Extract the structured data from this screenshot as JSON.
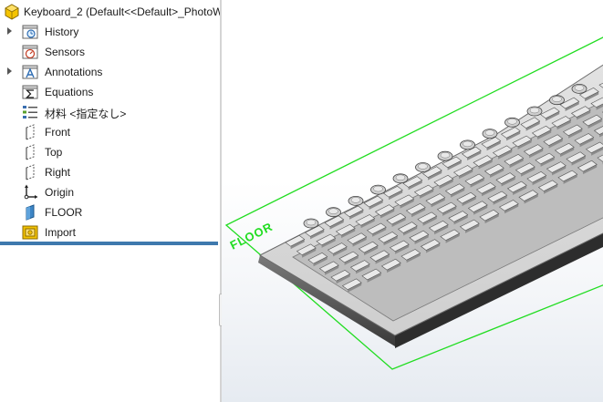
{
  "tree": {
    "root_label": "Keyboard_2  (Default<<Default>_PhotoW",
    "items": [
      {
        "label": "History",
        "expandable": true,
        "icon": "history-folder-icon"
      },
      {
        "label": "Sensors",
        "expandable": false,
        "icon": "sensors-icon"
      },
      {
        "label": "Annotations",
        "expandable": true,
        "icon": "annotations-icon"
      },
      {
        "label": "Equations",
        "expandable": false,
        "icon": "equations-icon"
      },
      {
        "label": "材料 <指定なし>",
        "expandable": false,
        "icon": "material-icon"
      },
      {
        "label": "Front",
        "expandable": false,
        "icon": "plane-icon"
      },
      {
        "label": "Top",
        "expandable": false,
        "icon": "plane-icon"
      },
      {
        "label": "Right",
        "expandable": false,
        "icon": "plane-icon"
      },
      {
        "label": "Origin",
        "expandable": false,
        "icon": "origin-icon"
      },
      {
        "label": "FLOOR",
        "expandable": false,
        "icon": "floor-plane-icon"
      },
      {
        "label": "Import",
        "expandable": false,
        "icon": "import-part-icon"
      }
    ]
  },
  "viewport": {
    "floor_label": "FLOOR",
    "colors": {
      "floor_outline": "#22dd22",
      "keyboard_body": "#d9d9d9",
      "key_top": "#e9e9e9",
      "key_side": "#8c8c8c",
      "rollback_bar": "#3e79ad"
    }
  }
}
